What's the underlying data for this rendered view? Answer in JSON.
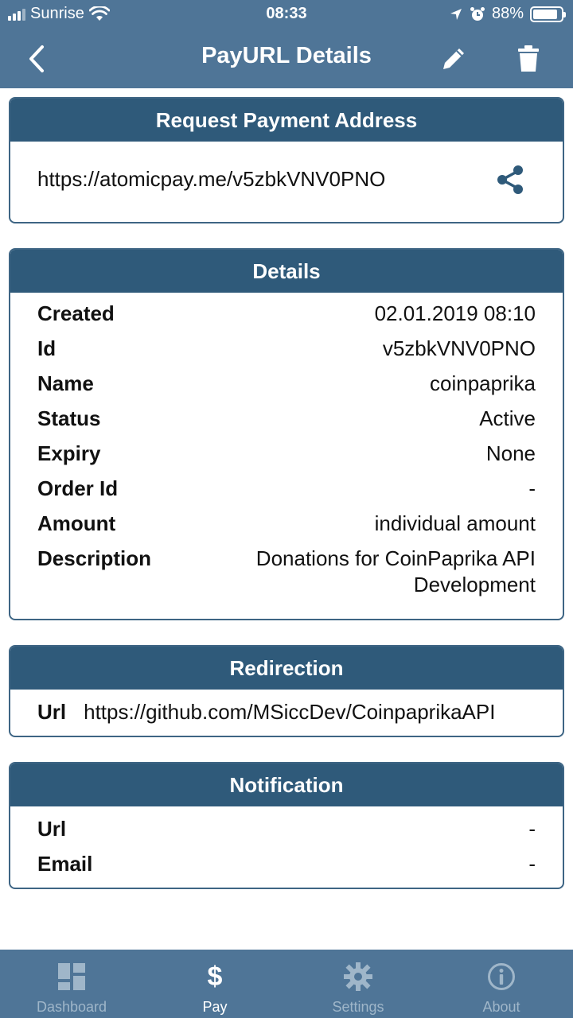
{
  "status_bar": {
    "carrier": "Sunrise",
    "time": "08:33",
    "battery": "88%",
    "battery_level": 0.88
  },
  "nav": {
    "title": "PayURL Details"
  },
  "request_card": {
    "title": "Request Payment Address",
    "address": "https://atomicpay.me/v5zbkVNV0PNO"
  },
  "details_card": {
    "title": "Details",
    "rows": [
      {
        "label": "Created",
        "value": "02.01.2019 08:10"
      },
      {
        "label": "Id",
        "value": "v5zbkVNV0PNO"
      },
      {
        "label": "Name",
        "value": "coinpaprika"
      },
      {
        "label": "Status",
        "value": "Active"
      },
      {
        "label": "Expiry",
        "value": "None"
      },
      {
        "label": "Order Id",
        "value": "-"
      },
      {
        "label": "Amount",
        "value": "individual amount"
      },
      {
        "label": "Description",
        "value_line1": "Donations for CoinPaprika API",
        "value_line2": "Development"
      }
    ]
  },
  "redirection_card": {
    "title": "Redirection",
    "label": "Url",
    "value": "https://github.com/MSiccDev/CoinpaprikaAPI"
  },
  "notification_card": {
    "title": "Notification",
    "rows": [
      {
        "label": "Url",
        "value": "-"
      },
      {
        "label": "Email",
        "value": "-"
      }
    ]
  },
  "tabs": [
    {
      "label": "Dashboard",
      "icon": "dashboard-icon"
    },
    {
      "label": "Pay",
      "icon": "dollar-icon"
    },
    {
      "label": "Settings",
      "icon": "gear-icon"
    },
    {
      "label": "About",
      "icon": "info-icon"
    }
  ],
  "colors": {
    "header": "#4f7597",
    "card_header": "#2f5a7a",
    "card_border": "#3e6584",
    "tab_inactive": "#9fb6c9"
  }
}
